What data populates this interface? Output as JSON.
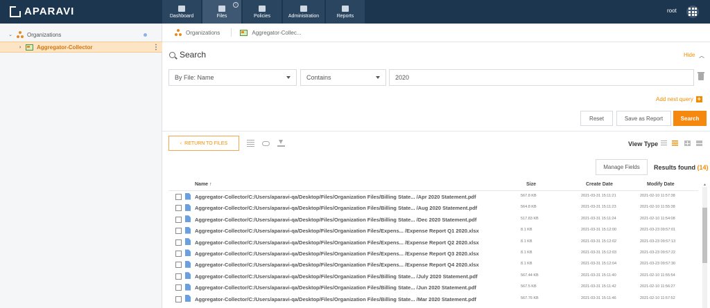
{
  "app": {
    "brand": "APARAVI",
    "user": "root"
  },
  "nav": [
    {
      "label": "Dashboard",
      "icon": "dashboard-icon"
    },
    {
      "label": "Files",
      "icon": "folder-icon",
      "active": true
    },
    {
      "label": "Policies",
      "icon": "gear-icon"
    },
    {
      "label": "Administration",
      "icon": "users-icon"
    },
    {
      "label": "Reports",
      "icon": "clipboard-icon"
    }
  ],
  "sidebar": {
    "root": "Organizations",
    "child": "Aggregator-Collector"
  },
  "breadcrumb": [
    "Organizations",
    "Aggregator-Collec..."
  ],
  "search": {
    "title": "Search",
    "hide": "Hide",
    "field": "By File: Name",
    "operator": "Contains",
    "value": "2020",
    "add_query": "Add next query",
    "reset": "Reset",
    "save_report": "Save as Report",
    "search_btn": "Search"
  },
  "toolbar": {
    "return": "RETURN TO FILES",
    "view_type": "View Type"
  },
  "results": {
    "manage_fields": "Manage Fields",
    "label": "Results found",
    "count": "(14)"
  },
  "table": {
    "headers": {
      "name": "Name",
      "size": "Size",
      "created": "Create Date",
      "modified": "Modify Date"
    },
    "rows": [
      {
        "name": "Aggregator-Collector/C:/Users/aparavi-qa/Desktop/Files/Organization Files/Billing State... /Apr 2020 Statement.pdf",
        "size": "567.8 KB",
        "created": "2021-03-31 15:11:21",
        "modified": "2021-02-10 11:57:38"
      },
      {
        "name": "Aggregator-Collector/C:/Users/aparavi-qa/Desktop/Files/Organization Files/Billing State... /Aug 2020 Statement.pdf",
        "size": "564.8 KB",
        "created": "2021-03-31 15:11:23",
        "modified": "2021-02-10 11:55:38"
      },
      {
        "name": "Aggregator-Collector/C:/Users/aparavi-qa/Desktop/Files/Organization Files/Billing State... /Dec 2020 Statement.pdf",
        "size": "517.83 KB",
        "created": "2021-03-31 15:11:24",
        "modified": "2021-02-10 11:54:08"
      },
      {
        "name": "Aggregator-Collector/C:/Users/aparavi-qa/Desktop/Files/Organization Files/Expens... /Expense Report Q1 2020.xlsx",
        "size": "8.1 KB",
        "created": "2021-03-31 15:12:00",
        "modified": "2021-03-23 09:57:01"
      },
      {
        "name": "Aggregator-Collector/C:/Users/aparavi-qa/Desktop/Files/Organization Files/Expens... /Expense Report Q2 2020.xlsx",
        "size": "8.1 KB",
        "created": "2021-03-31 15:12:02",
        "modified": "2021-03-23 09:57:13"
      },
      {
        "name": "Aggregator-Collector/C:/Users/aparavi-qa/Desktop/Files/Organization Files/Expens... /Expense Report Q3 2020.xlsx",
        "size": "8.1 KB",
        "created": "2021-03-31 15:12:03",
        "modified": "2021-03-23 09:57:22"
      },
      {
        "name": "Aggregator-Collector/C:/Users/aparavi-qa/Desktop/Files/Organization Files/Expens... /Expense Report Q4 2020.xlsx",
        "size": "8.1 KB",
        "created": "2021-03-31 15:12:04",
        "modified": "2021-03-23 09:57:30"
      },
      {
        "name": "Aggregator-Collector/C:/Users/aparavi-qa/Desktop/Files/Organization Files/Billing State... /July 2020 Statement.pdf",
        "size": "567.44 KB",
        "created": "2021-03-31 15:11:40",
        "modified": "2021-02-10 11:55:54"
      },
      {
        "name": "Aggregator-Collector/C:/Users/aparavi-qa/Desktop/Files/Organization Files/Billing State... /Jun 2020 Statement.pdf",
        "size": "567.5 KB",
        "created": "2021-03-31 15:11:42",
        "modified": "2021-02-10 11:56:27"
      },
      {
        "name": "Aggregator-Collector/C:/Users/aparavi-qa/Desktop/Files/Organization Files/Billing State... /Mar 2020 Statement.pdf",
        "size": "567.76 KB",
        "created": "2021-03-31 15:11:46",
        "modified": "2021-02-10 11:57:52"
      }
    ]
  },
  "colors": {
    "topbar": "#1d3650",
    "accent": "#f5890f",
    "selected_row": "#fde4c4"
  }
}
